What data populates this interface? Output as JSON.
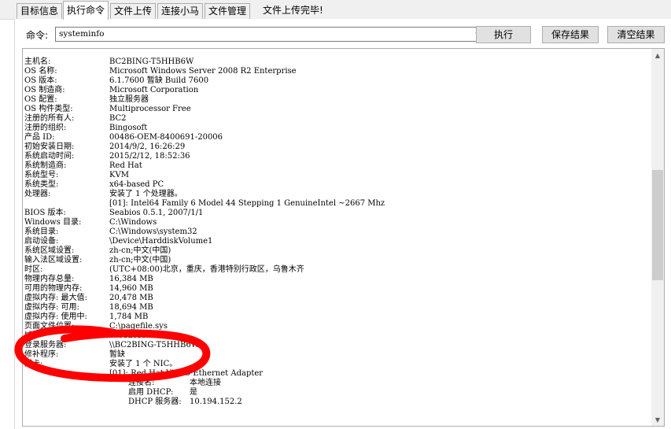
{
  "tabs": [
    {
      "label": "目标信息",
      "active": false
    },
    {
      "label": "执行命令",
      "active": true
    },
    {
      "label": "文件上传",
      "active": false
    },
    {
      "label": "连接小马",
      "active": false
    },
    {
      "label": "文件管理",
      "active": false
    }
  ],
  "status_message": "文件上传完毕!",
  "command": {
    "label": "命令:",
    "value": "systeminfo"
  },
  "buttons": {
    "execute": "执行",
    "save": "保存结果",
    "clear": "清空结果"
  },
  "output": {
    "lines": [
      {
        "key": "主机名:",
        "value": "BC2BING-T5HHB6W"
      },
      {
        "key": "OS 名称:",
        "value": "Microsoft Windows Server 2008 R2 Enterprise"
      },
      {
        "key": "OS 版本:",
        "value": "6.1.7600 暂缺 Build 7600"
      },
      {
        "key": "OS 制造商:",
        "value": "Microsoft Corporation"
      },
      {
        "key": "OS 配置:",
        "value": "独立服务器"
      },
      {
        "key": "OS 构件类型:",
        "value": "Multiprocessor Free"
      },
      {
        "key": "注册的所有人:",
        "value": "BC2"
      },
      {
        "key": "注册的组织:",
        "value": "Bingosoft"
      },
      {
        "key": "产品 ID:",
        "value": "00486-OEM-8400691-20006"
      },
      {
        "key": "初始安装日期:",
        "value": "2014/9/2, 16:26:29"
      },
      {
        "key": "系统启动时间:",
        "value": "2015/2/12, 18:52:36"
      },
      {
        "key": "系统制造商:",
        "value": "Red Hat"
      },
      {
        "key": "系统型号:",
        "value": "KVM"
      },
      {
        "key": "系统类型:",
        "value": "x64-based PC"
      },
      {
        "key": "处理器:",
        "value": "安装了 1 个处理器。"
      },
      {
        "key": "",
        "value": "[01]: Intel64 Family 6 Model 44 Stepping 1 GenuineIntel ~2667 Mhz"
      },
      {
        "key": "BIOS 版本:",
        "value": "Seabios 0.5.1, 2007/1/1"
      },
      {
        "key": "Windows 目录:",
        "value": "C:\\Windows"
      },
      {
        "key": "系统目录:",
        "value": "C:\\Windows\\system32"
      },
      {
        "key": "启动设备:",
        "value": "\\Device\\HarddiskVolume1"
      },
      {
        "key": "系统区域设置:",
        "value": "zh-cn;中文(中国)"
      },
      {
        "key": "输入法区域设置:",
        "value": "zh-cn;中文(中国)"
      },
      {
        "key": "时区:",
        "value": "(UTC+08:00)北京，重庆，香港特别行政区，乌鲁木齐"
      },
      {
        "key": "物理内存总量:",
        "value": "16,384 MB"
      },
      {
        "key": "可用的物理内存:",
        "value": "14,960 MB"
      },
      {
        "key": "虚拟内存: 最大值:",
        "value": "20,478 MB"
      },
      {
        "key": "虚拟内存: 可用:",
        "value": "18,694 MB"
      },
      {
        "key": "虚拟内存: 使用中:",
        "value": "1,784 MB"
      },
      {
        "key": "页面文件位置:",
        "value": "C:\\pagefile.sys"
      },
      {
        "key": "域:",
        "value": "WORKGROUP"
      },
      {
        "key": "登录服务器:",
        "value": "\\\\BC2BING-T5HHB6W"
      },
      {
        "key": "修补程序:",
        "value": "暂缺"
      },
      {
        "key": "网卡:",
        "value": "安装了 1 个 NIC。"
      },
      {
        "key": "",
        "value": "[01]: Red Hat VirtIO Ethernet Adapter"
      }
    ],
    "nic_lines": [
      {
        "key": "连接名:",
        "value": "本地连接"
      },
      {
        "key": "启用 DHCP:",
        "value": "是"
      },
      {
        "key": "DHCP 服务器:",
        "value": "10.194.152.2"
      }
    ]
  },
  "colors": {
    "annotation": "#ff0000",
    "chrome": "#f0f0f0",
    "button_face": "#e1e1e1",
    "scroll_thumb": "#cdcdcd"
  },
  "icons": {
    "combo_arrow": "chevron-down-icon",
    "scroll_up": "scroll-up-arrow-icon",
    "scroll_down": "scroll-down-arrow-icon"
  }
}
